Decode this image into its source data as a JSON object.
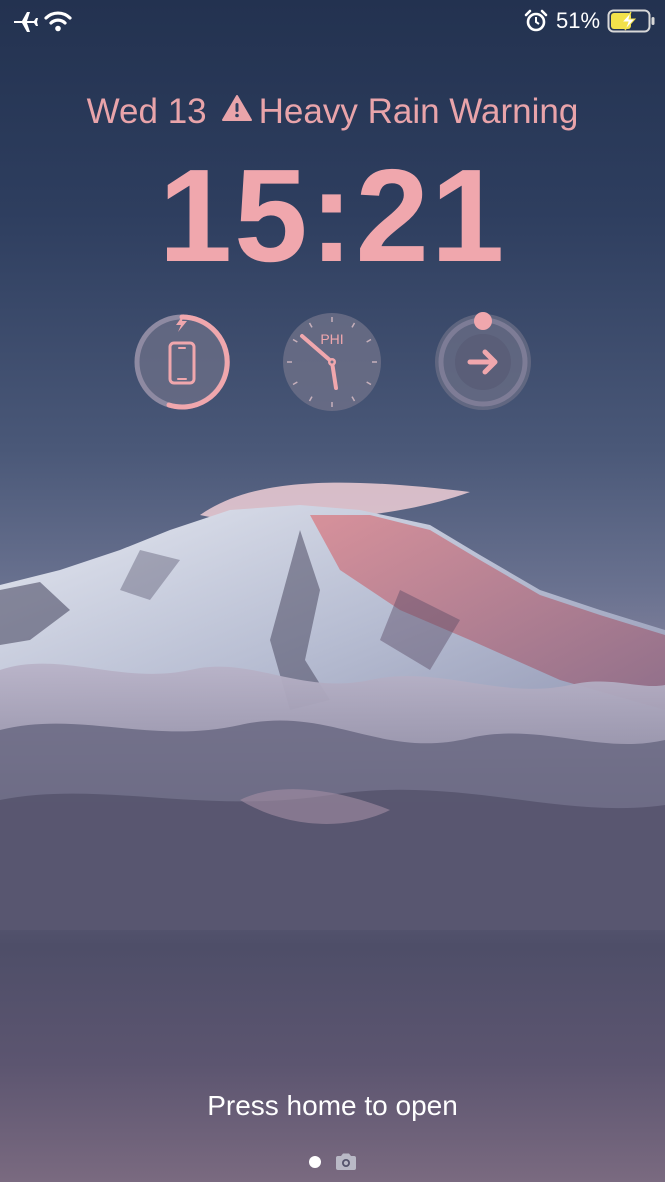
{
  "status_bar": {
    "battery_percent": "51%",
    "icons": [
      "airplane-icon",
      "wifi-icon",
      "alarm-icon",
      "battery-charging-icon"
    ]
  },
  "header": {
    "date": "Wed 13",
    "weather_alert": "Heavy Rain Warning",
    "time": "15:21"
  },
  "widgets": {
    "battery": {
      "icon": "phone-icon",
      "charging": true
    },
    "world_clock": {
      "city": "PHI"
    },
    "shortcut": {
      "icon": "arrow-right-icon"
    }
  },
  "footer": {
    "unlock_hint": "Press home to open",
    "icons": [
      "page-dot",
      "camera-icon"
    ]
  },
  "colors": {
    "accent_pink": "#f0a7ad",
    "widget_bg": "#6e7088",
    "battery_fill": "#f2e14b"
  }
}
